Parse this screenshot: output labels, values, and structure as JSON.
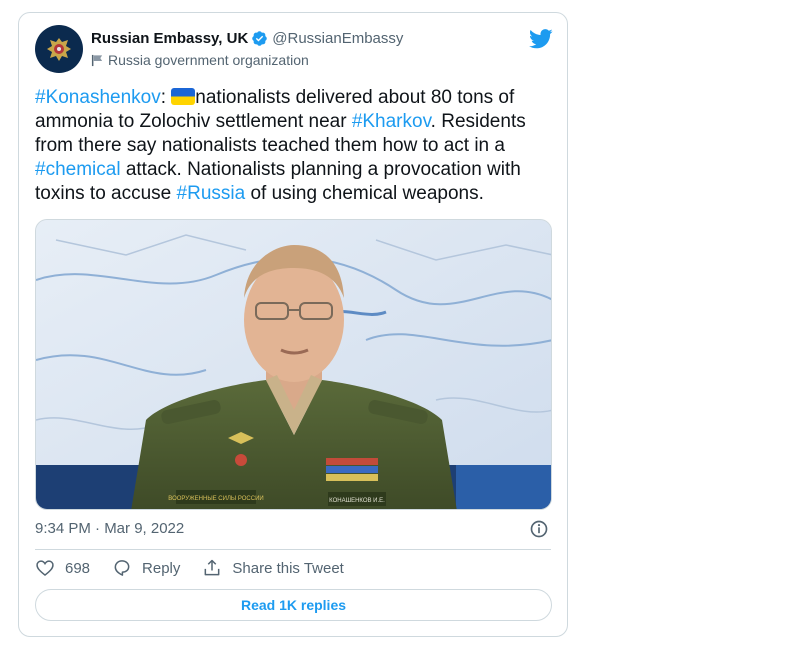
{
  "account": {
    "name": "Russian Embassy, UK",
    "handle": "@RussianEmbassy",
    "label": "Russia government organization",
    "avatar_icon": "russian-coat-of-arms-icon",
    "verified_icon": "verified-badge-icon"
  },
  "tweet": {
    "hashtag_konashenkov": "#Konashenkov",
    "colon": ":",
    "flag_icon": "ukraine-flag-emoji",
    "text_part1": "nationalists delivered about 80 tons of ammonia to Zolochiv settlement near ",
    "hashtag_kharkov": "#Kharkov",
    "text_part2": ". Residents from there say nationalists teached them how to act in a ",
    "hashtag_chemical": "#chemical",
    "text_part3": " attack. Nationalists planning a provocation with toxins to accuse ",
    "hashtag_russia": "#Russia",
    "text_part4": " of using chemical weapons.",
    "timestamp": "9:34 PM · Mar 9, 2022"
  },
  "media": {
    "name_tag": "КОНАШЕНКОВ И.Е.",
    "chest_tag": "ВООРУЖЕННЫЕ СИЛЫ РОССИИ"
  },
  "actions": {
    "like_count": "698",
    "reply_label": "Reply",
    "share_label": "Share this Tweet"
  },
  "read_replies_label": "Read 1K replies",
  "colors": {
    "link": "#1d9bf0",
    "secondary_text": "#536471",
    "border": "#cfd9de"
  }
}
